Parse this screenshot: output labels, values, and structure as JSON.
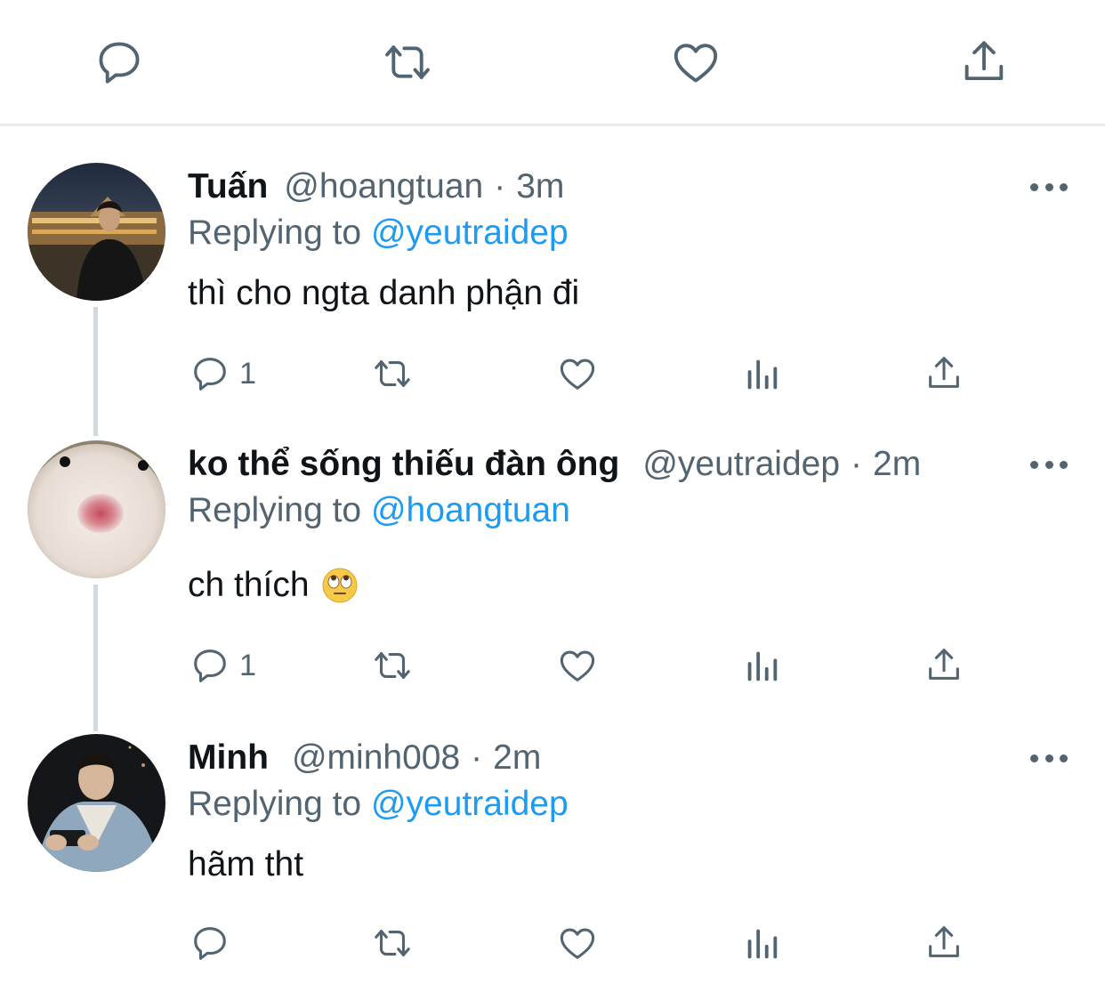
{
  "top_actions": {
    "reply_icon": "reply-bubble-icon",
    "retweet_icon": "retweet-icon",
    "like_icon": "heart-icon",
    "share_icon": "share-icon"
  },
  "tweets": [
    {
      "name": "Tuấn",
      "handle": "@hoangtuan",
      "separator": "·",
      "time": "3m",
      "replying_prefix": "Replying to",
      "replying_to": "@yeutraidep",
      "text": "thì cho ngta danh phận đi",
      "reply_count": "1",
      "avatar": "avatar-photo-man-night-city"
    },
    {
      "name": "ko thể sống thiếu đàn ông",
      "handle": "@yeutraidep",
      "separator": "·",
      "time": "2m",
      "replying_prefix": "Replying to",
      "replying_to": "@hoangtuan",
      "text": "ch thích",
      "emoji": "rolling-eyes-emoji",
      "reply_count": "1",
      "avatar": "avatar-hamster-closeup"
    },
    {
      "name": "Minh",
      "handle": "@minh008",
      "separator": "·",
      "time": "2m",
      "replying_prefix": "Replying to",
      "replying_to": "@yeutraidep",
      "text": "hãm tht",
      "reply_count": "",
      "avatar": "avatar-man-denim-jacket-phone"
    }
  ],
  "colors": {
    "text": "#0f1419",
    "secondary": "#536471",
    "mention": "#1d9bf0",
    "divider": "#e6ecf0",
    "thread_line": "#cfd9de"
  }
}
